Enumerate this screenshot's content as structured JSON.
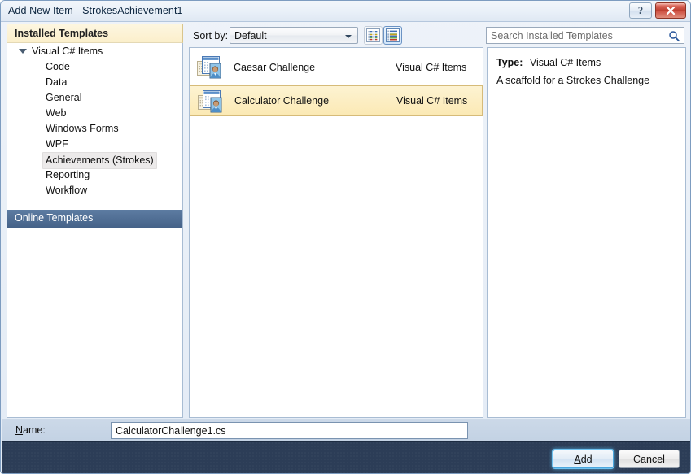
{
  "window": {
    "title": "Add New Item - StrokesAchievement1",
    "help_button": "?",
    "close_button": "✕"
  },
  "toolbar": {
    "sort_by_label": "Sort by:",
    "sort_by_value": "Default",
    "view_small_icon": "small-icons-view-icon",
    "view_medium_icon": "medium-icons-view-icon"
  },
  "search": {
    "placeholder": "Search Installed Templates",
    "icon": "search-icon"
  },
  "sidebar": {
    "installed_header": "Installed Templates",
    "root": {
      "label": "Visual C# Items",
      "expander_icon": "expander-expanded-icon"
    },
    "items": [
      {
        "label": "Code",
        "selected": false
      },
      {
        "label": "Data",
        "selected": false
      },
      {
        "label": "General",
        "selected": false
      },
      {
        "label": "Web",
        "selected": false
      },
      {
        "label": "Windows Forms",
        "selected": false
      },
      {
        "label": "WPF",
        "selected": false
      },
      {
        "label": "Achievements (Strokes)",
        "selected": true
      },
      {
        "label": "Reporting",
        "selected": false
      },
      {
        "label": "Workflow",
        "selected": false
      }
    ],
    "online_header": "Online Templates"
  },
  "templates": [
    {
      "name": "Caesar Challenge",
      "category": "Visual C# Items",
      "icon": "template-item-icon",
      "selected": false
    },
    {
      "name": "Calculator Challenge",
      "category": "Visual C# Items",
      "icon": "template-item-icon",
      "selected": true
    }
  ],
  "details": {
    "type_label": "Type:",
    "type_value": "Visual C# Items",
    "description": "A scaffold for a Strokes Challenge"
  },
  "name_row": {
    "label_prefix": "",
    "label_accel": "N",
    "label_suffix": "ame:",
    "value": "CalculatorChallenge1.cs"
  },
  "footer": {
    "add_accel": "A",
    "add_suffix": "dd",
    "cancel_label": "Cancel"
  },
  "colors": {
    "accent_blue": "#4ba6dd",
    "selection_amber": "#fbe9b4",
    "online_header_blue": "#4a6a92",
    "footer_navy": "#2c3d57",
    "installed_header_cream": "#fbefcb"
  }
}
